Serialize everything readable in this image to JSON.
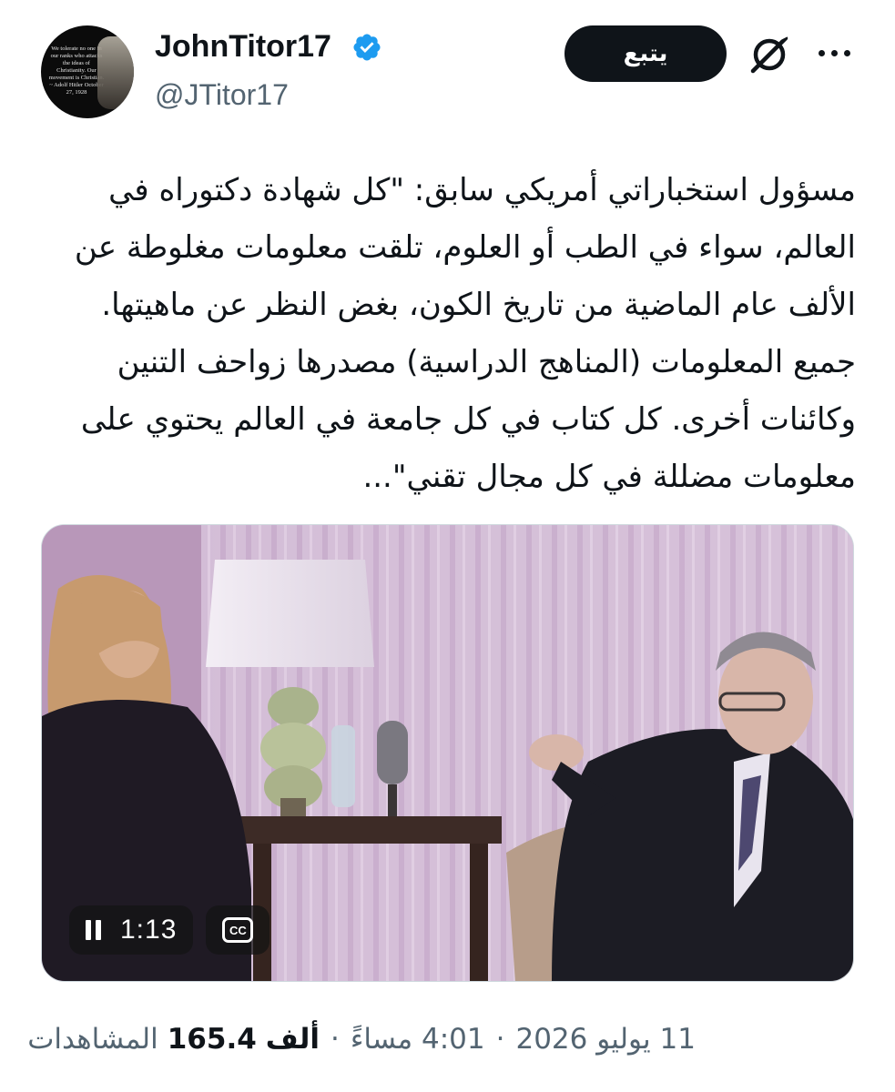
{
  "user": {
    "display_name": "JohnTitor17",
    "handle": "@JTitor17",
    "verified_icon": "verified-badge-icon",
    "avatar_quote": "We tolerate no one in our ranks who attacks the ideas of Christianity. Our movement is Christian. ~ Adolf Hitler October 27, 1928"
  },
  "actions": {
    "follow_label": "يتبع",
    "grok_icon": "grok-icon",
    "more_icon": "more-icon"
  },
  "tweet": {
    "text": "مسؤول استخباراتي أمريكي سابق: \"كل شهادة دكتوراه في العالم، سواء في الطب أو العلوم، تلقت معلومات مغلوطة عن الألف عام الماضية من تاريخ الكون، بغض النظر عن ماهيتها. جميع المعلومات (المناهج الدراسية) مصدرها زواحف التنين وكائنات أخرى. كل كتاب في كل جامعة في العالم يحتوي على معلومات مضللة في كل مجال تقني\"..."
  },
  "video": {
    "time": "1:13",
    "pause_icon": "pause-icon",
    "cc_label": "CC",
    "cc_icon": "closed-captions-icon"
  },
  "meta": {
    "date": "11 يوليو 2026",
    "time": "4:01 مساءً",
    "views_count": "165.4",
    "views_unit": "ألف",
    "views_label": "المشاهدات",
    "separator": "·"
  },
  "colors": {
    "text_primary": "#0f1419",
    "text_secondary": "#536471",
    "verified_blue": "#1d9bf0",
    "button_dark": "#0f1419"
  }
}
